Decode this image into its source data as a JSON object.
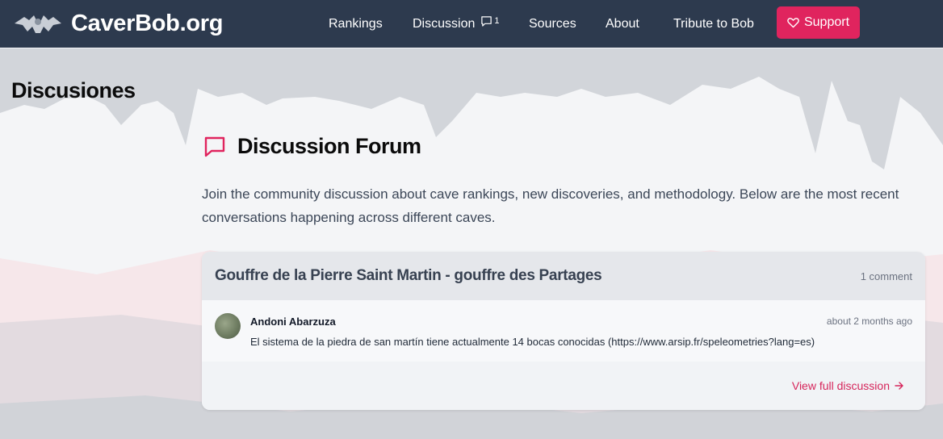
{
  "brand": {
    "name": "CaverBob.org",
    "logo_icon": "bat-icon"
  },
  "nav": {
    "rankings": "Rankings",
    "discussion": "Discussion",
    "discussion_count": "1",
    "sources": "Sources",
    "about": "About",
    "tribute": "Tribute to Bob",
    "support": "Support"
  },
  "page": {
    "title": "Discusiones",
    "forum_title": "Discussion Forum",
    "intro": "Join the community discussion about cave rankings, new discoveries, and methodology. Below are the most recent conversations happening across different caves."
  },
  "discussions": [
    {
      "cave": "Gouffre de la Pierre Saint Martin - gouffre des Partages",
      "comment_count": "1 comment",
      "comment": {
        "author": "Andoni Abarzuza",
        "time": "about 2 months ago",
        "text": "El sistema de la piedra de san martín tiene actualmente 14 bocas conocidas (https://www.arsip.fr/speleometries?lang=es)"
      },
      "view_link": "View full discussion"
    }
  ],
  "colors": {
    "navbar": "#2d3a4e",
    "accent": "#e0245e",
    "link": "#d6245a"
  }
}
